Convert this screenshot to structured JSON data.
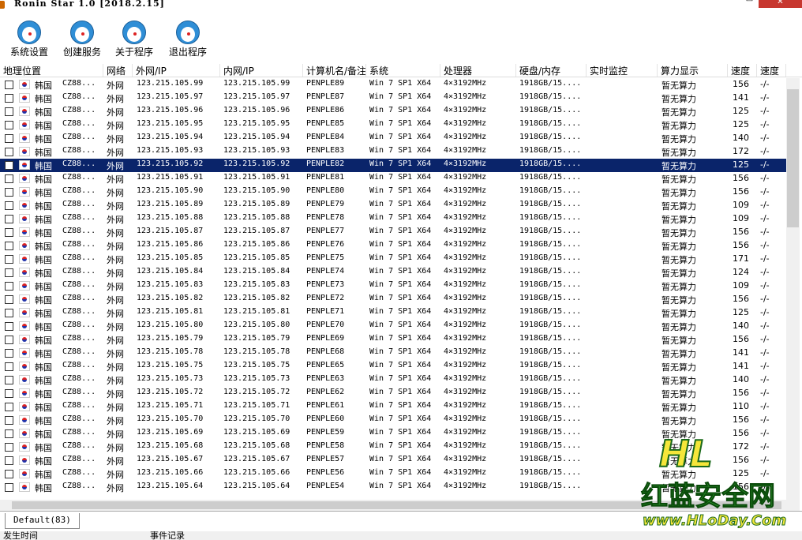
{
  "window": {
    "title": "Ronin Star 1.0 [2018.2.15]",
    "minimize": "–",
    "maximize": "□",
    "close": "✕"
  },
  "toolbar": [
    {
      "label": "系统设置",
      "icon": "doraemon-icon"
    },
    {
      "label": "创建服务",
      "icon": "doraemon-icon"
    },
    {
      "label": "关于程序",
      "icon": "doraemon-icon"
    },
    {
      "label": "退出程序",
      "icon": "doraemon-sad-icon"
    }
  ],
  "columns": [
    "地理位置",
    "网络",
    "外网/IP",
    "内网/IP",
    "计算机名/备注",
    "系统",
    "处理器",
    "硬盘/内存",
    "实时监控",
    "算力显示",
    "速度",
    "速度"
  ],
  "rows": [
    {
      "loc": "韩国",
      "isp": "CZ88...",
      "net": "外网",
      "wan": "123.215.105.99",
      "lan": "123.215.105.99",
      "name": "PENPLE89",
      "os": "Win 7 SP1 X64",
      "cpu": "4×3192MHz",
      "disk": "1918GB/15....",
      "hash": "暂无算力",
      "speed": "156",
      "speed2": "-/-"
    },
    {
      "loc": "韩国",
      "isp": "CZ88...",
      "net": "外网",
      "wan": "123.215.105.97",
      "lan": "123.215.105.97",
      "name": "PENPLE87",
      "os": "Win 7 SP1 X64",
      "cpu": "4×3192MHz",
      "disk": "1918GB/15....",
      "hash": "暂无算力",
      "speed": "141",
      "speed2": "-/-"
    },
    {
      "loc": "韩国",
      "isp": "CZ88...",
      "net": "外网",
      "wan": "123.215.105.96",
      "lan": "123.215.105.96",
      "name": "PENPLE86",
      "os": "Win 7 SP1 X64",
      "cpu": "4×3192MHz",
      "disk": "1918GB/15....",
      "hash": "暂无算力",
      "speed": "125",
      "speed2": "-/-"
    },
    {
      "loc": "韩国",
      "isp": "CZ88...",
      "net": "外网",
      "wan": "123.215.105.95",
      "lan": "123.215.105.95",
      "name": "PENPLE85",
      "os": "Win 7 SP1 X64",
      "cpu": "4×3192MHz",
      "disk": "1918GB/15....",
      "hash": "暂无算力",
      "speed": "125",
      "speed2": "-/-"
    },
    {
      "loc": "韩国",
      "isp": "CZ88...",
      "net": "外网",
      "wan": "123.215.105.94",
      "lan": "123.215.105.94",
      "name": "PENPLE84",
      "os": "Win 7 SP1 X64",
      "cpu": "4×3192MHz",
      "disk": "1918GB/15....",
      "hash": "暂无算力",
      "speed": "140",
      "speed2": "-/-"
    },
    {
      "loc": "韩国",
      "isp": "CZ88...",
      "net": "外网",
      "wan": "123.215.105.93",
      "lan": "123.215.105.93",
      "name": "PENPLE83",
      "os": "Win 7 SP1 X64",
      "cpu": "4×3192MHz",
      "disk": "1918GB/15....",
      "hash": "暂无算力",
      "speed": "172",
      "speed2": "-/-"
    },
    {
      "loc": "韩国",
      "isp": "CZ88...",
      "net": "外网",
      "wan": "123.215.105.92",
      "lan": "123.215.105.92",
      "name": "PENPLE82",
      "os": "Win 7 SP1 X64",
      "cpu": "4×3192MHz",
      "disk": "1918GB/15....",
      "hash": "暂无算力",
      "speed": "125",
      "speed2": "-/-",
      "selected": true
    },
    {
      "loc": "韩国",
      "isp": "CZ88...",
      "net": "外网",
      "wan": "123.215.105.91",
      "lan": "123.215.105.91",
      "name": "PENPLE81",
      "os": "Win 7 SP1 X64",
      "cpu": "4×3192MHz",
      "disk": "1918GB/15....",
      "hash": "暂无算力",
      "speed": "156",
      "speed2": "-/-"
    },
    {
      "loc": "韩国",
      "isp": "CZ88...",
      "net": "外网",
      "wan": "123.215.105.90",
      "lan": "123.215.105.90",
      "name": "PENPLE80",
      "os": "Win 7 SP1 X64",
      "cpu": "4×3192MHz",
      "disk": "1918GB/15....",
      "hash": "暂无算力",
      "speed": "156",
      "speed2": "-/-"
    },
    {
      "loc": "韩国",
      "isp": "CZ88...",
      "net": "外网",
      "wan": "123.215.105.89",
      "lan": "123.215.105.89",
      "name": "PENPLE79",
      "os": "Win 7 SP1 X64",
      "cpu": "4×3192MHz",
      "disk": "1918GB/15....",
      "hash": "暂无算力",
      "speed": "109",
      "speed2": "-/-"
    },
    {
      "loc": "韩国",
      "isp": "CZ88...",
      "net": "外网",
      "wan": "123.215.105.88",
      "lan": "123.215.105.88",
      "name": "PENPLE78",
      "os": "Win 7 SP1 X64",
      "cpu": "4×3192MHz",
      "disk": "1918GB/15....",
      "hash": "暂无算力",
      "speed": "109",
      "speed2": "-/-"
    },
    {
      "loc": "韩国",
      "isp": "CZ88...",
      "net": "外网",
      "wan": "123.215.105.87",
      "lan": "123.215.105.87",
      "name": "PENPLE77",
      "os": "Win 7 SP1 X64",
      "cpu": "4×3192MHz",
      "disk": "1918GB/15....",
      "hash": "暂无算力",
      "speed": "156",
      "speed2": "-/-"
    },
    {
      "loc": "韩国",
      "isp": "CZ88...",
      "net": "外网",
      "wan": "123.215.105.86",
      "lan": "123.215.105.86",
      "name": "PENPLE76",
      "os": "Win 7 SP1 X64",
      "cpu": "4×3192MHz",
      "disk": "1918GB/15....",
      "hash": "暂无算力",
      "speed": "156",
      "speed2": "-/-"
    },
    {
      "loc": "韩国",
      "isp": "CZ88...",
      "net": "外网",
      "wan": "123.215.105.85",
      "lan": "123.215.105.85",
      "name": "PENPLE75",
      "os": "Win 7 SP1 X64",
      "cpu": "4×3192MHz",
      "disk": "1918GB/15....",
      "hash": "暂无算力",
      "speed": "171",
      "speed2": "-/-"
    },
    {
      "loc": "韩国",
      "isp": "CZ88...",
      "net": "外网",
      "wan": "123.215.105.84",
      "lan": "123.215.105.84",
      "name": "PENPLE74",
      "os": "Win 7 SP1 X64",
      "cpu": "4×3192MHz",
      "disk": "1918GB/15....",
      "hash": "暂无算力",
      "speed": "124",
      "speed2": "-/-"
    },
    {
      "loc": "韩国",
      "isp": "CZ88...",
      "net": "外网",
      "wan": "123.215.105.83",
      "lan": "123.215.105.83",
      "name": "PENPLE73",
      "os": "Win 7 SP1 X64",
      "cpu": "4×3192MHz",
      "disk": "1918GB/15....",
      "hash": "暂无算力",
      "speed": "109",
      "speed2": "-/-"
    },
    {
      "loc": "韩国",
      "isp": "CZ88...",
      "net": "外网",
      "wan": "123.215.105.82",
      "lan": "123.215.105.82",
      "name": "PENPLE72",
      "os": "Win 7 SP1 X64",
      "cpu": "4×3192MHz",
      "disk": "1918GB/15....",
      "hash": "暂无算力",
      "speed": "156",
      "speed2": "-/-"
    },
    {
      "loc": "韩国",
      "isp": "CZ88...",
      "net": "外网",
      "wan": "123.215.105.81",
      "lan": "123.215.105.81",
      "name": "PENPLE71",
      "os": "Win 7 SP1 X64",
      "cpu": "4×3192MHz",
      "disk": "1918GB/15....",
      "hash": "暂无算力",
      "speed": "125",
      "speed2": "-/-"
    },
    {
      "loc": "韩国",
      "isp": "CZ88...",
      "net": "外网",
      "wan": "123.215.105.80",
      "lan": "123.215.105.80",
      "name": "PENPLE70",
      "os": "Win 7 SP1 X64",
      "cpu": "4×3192MHz",
      "disk": "1918GB/15....",
      "hash": "暂无算力",
      "speed": "140",
      "speed2": "-/-"
    },
    {
      "loc": "韩国",
      "isp": "CZ88...",
      "net": "外网",
      "wan": "123.215.105.79",
      "lan": "123.215.105.79",
      "name": "PENPLE69",
      "os": "Win 7 SP1 X64",
      "cpu": "4×3192MHz",
      "disk": "1918GB/15....",
      "hash": "暂无算力",
      "speed": "156",
      "speed2": "-/-"
    },
    {
      "loc": "韩国",
      "isp": "CZ88...",
      "net": "外网",
      "wan": "123.215.105.78",
      "lan": "123.215.105.78",
      "name": "PENPLE68",
      "os": "Win 7 SP1 X64",
      "cpu": "4×3192MHz",
      "disk": "1918GB/15....",
      "hash": "暂无算力",
      "speed": "141",
      "speed2": "-/-"
    },
    {
      "loc": "韩国",
      "isp": "CZ88...",
      "net": "外网",
      "wan": "123.215.105.75",
      "lan": "123.215.105.75",
      "name": "PENPLE65",
      "os": "Win 7 SP1 X64",
      "cpu": "4×3192MHz",
      "disk": "1918GB/15....",
      "hash": "暂无算力",
      "speed": "141",
      "speed2": "-/-"
    },
    {
      "loc": "韩国",
      "isp": "CZ88...",
      "net": "外网",
      "wan": "123.215.105.73",
      "lan": "123.215.105.73",
      "name": "PENPLE63",
      "os": "Win 7 SP1 X64",
      "cpu": "4×3192MHz",
      "disk": "1918GB/15....",
      "hash": "暂无算力",
      "speed": "140",
      "speed2": "-/-"
    },
    {
      "loc": "韩国",
      "isp": "CZ88...",
      "net": "外网",
      "wan": "123.215.105.72",
      "lan": "123.215.105.72",
      "name": "PENPLE62",
      "os": "Win 7 SP1 X64",
      "cpu": "4×3192MHz",
      "disk": "1918GB/15....",
      "hash": "暂无算力",
      "speed": "156",
      "speed2": "-/-"
    },
    {
      "loc": "韩国",
      "isp": "CZ88...",
      "net": "外网",
      "wan": "123.215.105.71",
      "lan": "123.215.105.71",
      "name": "PENPLE61",
      "os": "Win 7 SP1 X64",
      "cpu": "4×3192MHz",
      "disk": "1918GB/15....",
      "hash": "暂无算力",
      "speed": "110",
      "speed2": "-/-"
    },
    {
      "loc": "韩国",
      "isp": "CZ88...",
      "net": "外网",
      "wan": "123.215.105.70",
      "lan": "123.215.105.70",
      "name": "PENPLE60",
      "os": "Win 7 SP1 X64",
      "cpu": "4×3192MHz",
      "disk": "1918GB/15....",
      "hash": "暂无算力",
      "speed": "156",
      "speed2": "-/-"
    },
    {
      "loc": "韩国",
      "isp": "CZ88...",
      "net": "外网",
      "wan": "123.215.105.69",
      "lan": "123.215.105.69",
      "name": "PENPLE59",
      "os": "Win 7 SP1 X64",
      "cpu": "4×3192MHz",
      "disk": "1918GB/15....",
      "hash": "暂无算力",
      "speed": "156",
      "speed2": "-/-"
    },
    {
      "loc": "韩国",
      "isp": "CZ88...",
      "net": "外网",
      "wan": "123.215.105.68",
      "lan": "123.215.105.68",
      "name": "PENPLE58",
      "os": "Win 7 SP1 X64",
      "cpu": "4×3192MHz",
      "disk": "1918GB/15....",
      "hash": "暂无算力",
      "speed": "172",
      "speed2": "-/-"
    },
    {
      "loc": "韩国",
      "isp": "CZ88...",
      "net": "外网",
      "wan": "123.215.105.67",
      "lan": "123.215.105.67",
      "name": "PENPLE57",
      "os": "Win 7 SP1 X64",
      "cpu": "4×3192MHz",
      "disk": "1918GB/15....",
      "hash": "暂无算力",
      "speed": "156",
      "speed2": "-/-"
    },
    {
      "loc": "韩国",
      "isp": "CZ88...",
      "net": "外网",
      "wan": "123.215.105.66",
      "lan": "123.215.105.66",
      "name": "PENPLE56",
      "os": "Win 7 SP1 X64",
      "cpu": "4×3192MHz",
      "disk": "1918GB/15....",
      "hash": "暂无算力",
      "speed": "125",
      "speed2": "-/-"
    },
    {
      "loc": "韩国",
      "isp": "CZ88...",
      "net": "外网",
      "wan": "123.215.105.64",
      "lan": "123.215.105.64",
      "name": "PENPLE54",
      "os": "Win 7 SP1 X64",
      "cpu": "4×3192MHz",
      "disk": "1918GB/15....",
      "hash": "暂无算力",
      "speed": "156",
      "speed2": "-/-"
    }
  ],
  "tab": {
    "label": "Default(83)"
  },
  "status": {
    "left": "发生时间",
    "right": "事件记录"
  },
  "watermark": {
    "line1": "HL",
    "line2": "红蓝安全网",
    "line3": "www.HLoDay.Com"
  },
  "colors": {
    "selection": "#0a246a",
    "close": "#c7372f"
  }
}
